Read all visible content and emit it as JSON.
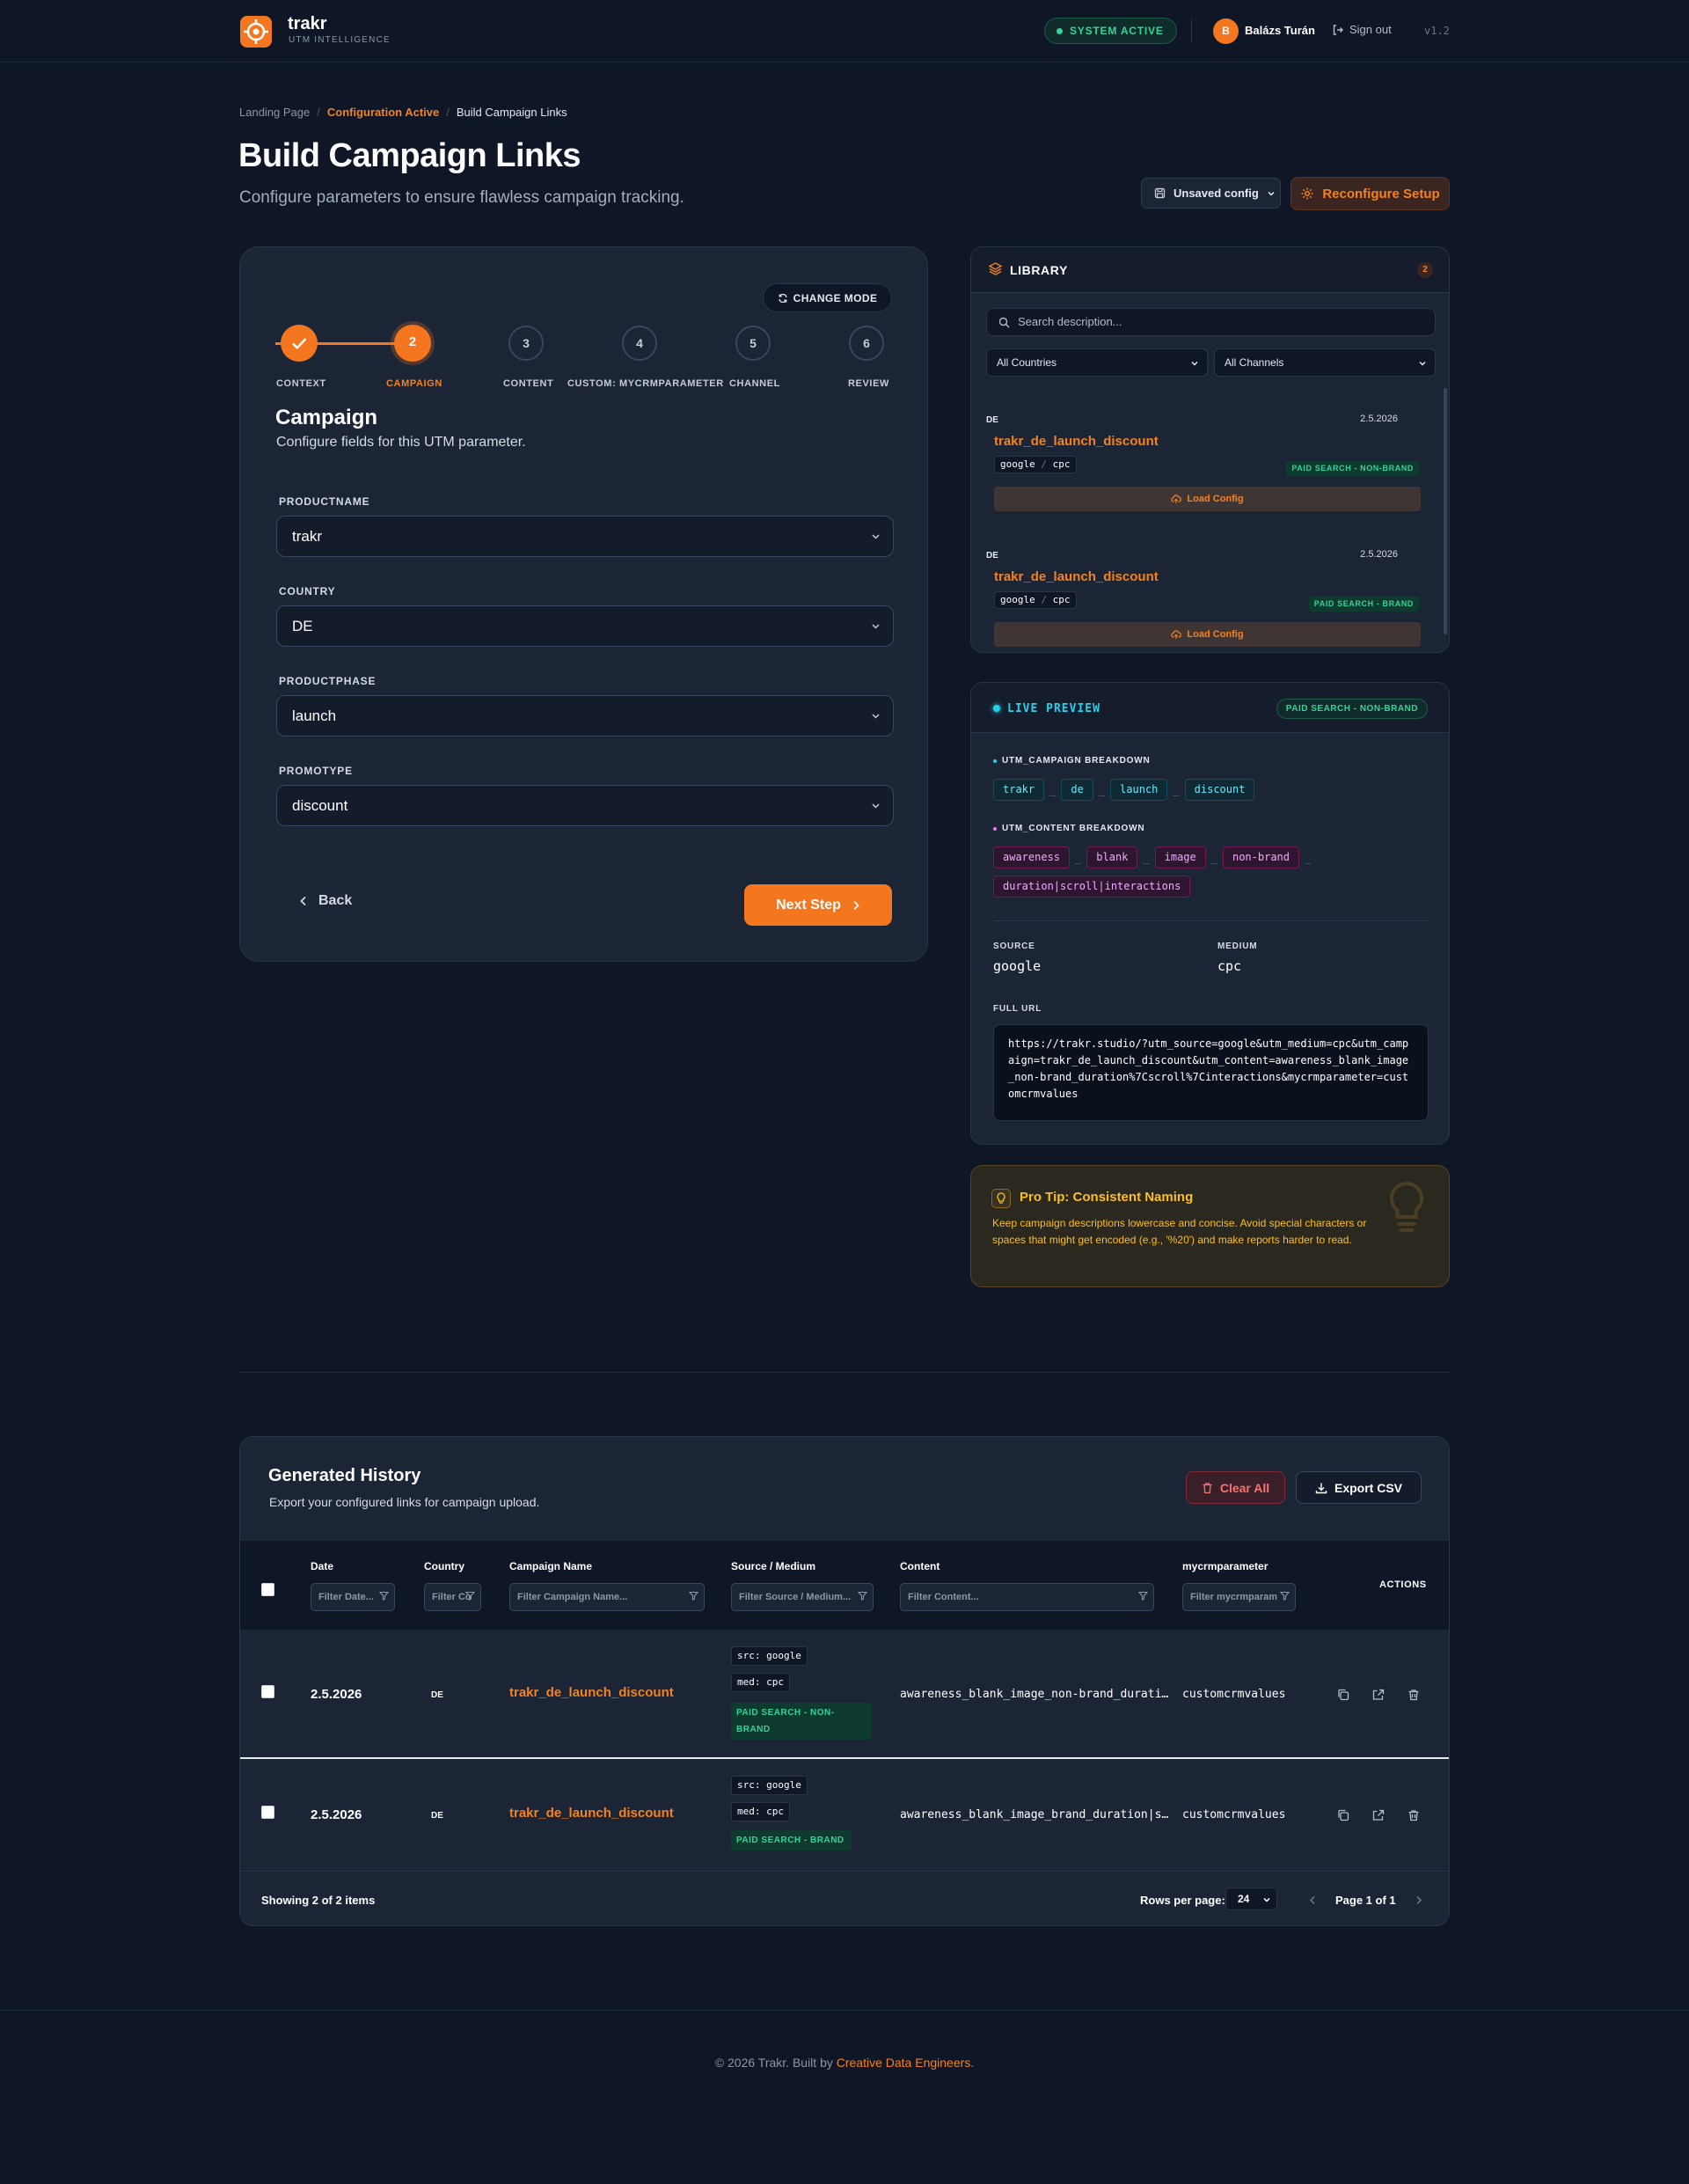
{
  "header": {
    "brand_name": "trakr",
    "brand_sub": "UTM INTELLIGENCE",
    "status": "SYSTEM ACTIVE",
    "avatar_initial": "B",
    "user_name": "Balázs Turán",
    "signout": "Sign out",
    "version": "v1.2"
  },
  "breadcrumb": {
    "items": [
      "Landing Page",
      "Configuration Active",
      "Build Campaign Links"
    ],
    "separator": "/"
  },
  "page": {
    "title": "Build Campaign Links",
    "subtitle": "Configure parameters to ensure flawless campaign tracking.",
    "unsaved_label": "Unsaved config",
    "reconfigure_label": "Reconfigure Setup"
  },
  "wizard": {
    "change_mode": "CHANGE MODE",
    "steps": [
      {
        "number": "",
        "label": "CONTEXT",
        "state": "done"
      },
      {
        "number": "2",
        "label": "CAMPAIGN",
        "state": "active"
      },
      {
        "number": "3",
        "label": "CONTENT",
        "state": "todo"
      },
      {
        "number": "4",
        "label": "CUSTOM: MYCRMPARAMETER",
        "state": "todo"
      },
      {
        "number": "5",
        "label": "CHANNEL",
        "state": "todo"
      },
      {
        "number": "6",
        "label": "REVIEW",
        "state": "todo"
      }
    ],
    "section_title": "Campaign",
    "section_sub": "Configure fields for this UTM parameter.",
    "fields": [
      {
        "label": "PRODUCTNAME",
        "value": "trakr"
      },
      {
        "label": "COUNTRY",
        "value": "DE"
      },
      {
        "label": "PRODUCTPHASE",
        "value": "launch"
      },
      {
        "label": "PROMOTYPE",
        "value": "discount"
      }
    ],
    "back_label": "Back",
    "next_label": "Next Step"
  },
  "library": {
    "title": "LIBRARY",
    "count": "2",
    "search_placeholder": "Search description...",
    "country_filter": "All Countries",
    "channel_filter": "All Channels",
    "items": [
      {
        "country": "DE",
        "date": "2.5.2026",
        "name": "trakr_de_launch_discount",
        "source": "google",
        "medium": "cpc",
        "sep": "/",
        "category": "PAID SEARCH - NON-BRAND",
        "load": "Load Config"
      },
      {
        "country": "DE",
        "date": "2.5.2026",
        "name": "trakr_de_launch_discount",
        "source": "google",
        "medium": "cpc",
        "sep": "/",
        "category": "PAID SEARCH - BRAND",
        "load": "Load Config"
      }
    ]
  },
  "preview": {
    "title": "LIVE PREVIEW",
    "badge": "PAID SEARCH - NON-BRAND",
    "campaign_label": "UTM_CAMPAIGN BREAKDOWN",
    "campaign_tokens": [
      "trakr",
      "de",
      "launch",
      "discount"
    ],
    "content_label": "UTM_CONTENT BREAKDOWN",
    "content_tokens": [
      "awareness",
      "blank",
      "image",
      "non-brand",
      "duration|scroll|interactions"
    ],
    "token_sep": "_",
    "source_label": "SOURCE",
    "source_value": "google",
    "medium_label": "MEDIUM",
    "medium_value": "cpc",
    "url_label": "FULL URL",
    "url": "https://trakr.studio/?utm_source=google&utm_medium=cpc&utm_campaign=trakr_de_launch_discount&utm_content=awareness_blank_image_non-brand_duration%7Cscroll%7Cinteractions&mycrmparameter=customcrmvalues"
  },
  "protip": {
    "title": "Pro Tip: Consistent Naming",
    "text": "Keep campaign descriptions lowercase and concise. Avoid special characters or spaces that might get encoded (e.g., '%20') and make reports harder to read."
  },
  "history": {
    "title": "Generated History",
    "subtitle": "Export your configured links for campaign upload.",
    "clear_label": "Clear All",
    "export_label": "Export CSV",
    "columns": [
      {
        "label": "Date",
        "filter": "Filter Date..."
      },
      {
        "label": "Country",
        "filter": "Filter Co"
      },
      {
        "label": "Campaign Name",
        "filter": "Filter Campaign Name..."
      },
      {
        "label": "Source / Medium",
        "filter": "Filter Source / Medium..."
      },
      {
        "label": "Content",
        "filter": "Filter Content..."
      },
      {
        "label": "mycrmparameter",
        "filter": "Filter mycrmparam"
      }
    ],
    "actions_label": "ACTIONS",
    "rows": [
      {
        "date": "2.5.2026",
        "country": "DE",
        "campaign": "trakr_de_launch_discount",
        "src": "src: google",
        "med": "med: cpc",
        "badge_line1": "PAID SEARCH - NON-",
        "badge_line2": "BRAND",
        "content": "awareness_blank_image_non-brand_durati…",
        "crm": "customcrmvalues"
      },
      {
        "date": "2.5.2026",
        "country": "DE",
        "campaign": "trakr_de_launch_discount",
        "src": "src: google",
        "med": "med: cpc",
        "badge_line1": "PAID SEARCH - BRAND",
        "badge_line2": "",
        "content": "awareness_blank_image_brand_duration|s…",
        "crm": "customcrmvalues"
      }
    ],
    "showing": "Showing 2 of 2 items",
    "rows_per_page_label": "Rows per page:",
    "rows_per_page": "24",
    "page_label": "Page 1 of 1"
  },
  "footer": {
    "text": "© 2026 Trakr. Built by",
    "link": "Creative Data Engineers",
    "end": "."
  },
  "colors": {
    "accent": "#f4761e",
    "background": "#0f1626",
    "card": "#1c2535",
    "success": "#34d399",
    "cyan": "#22d3ee",
    "tip": "#fbbf24"
  }
}
